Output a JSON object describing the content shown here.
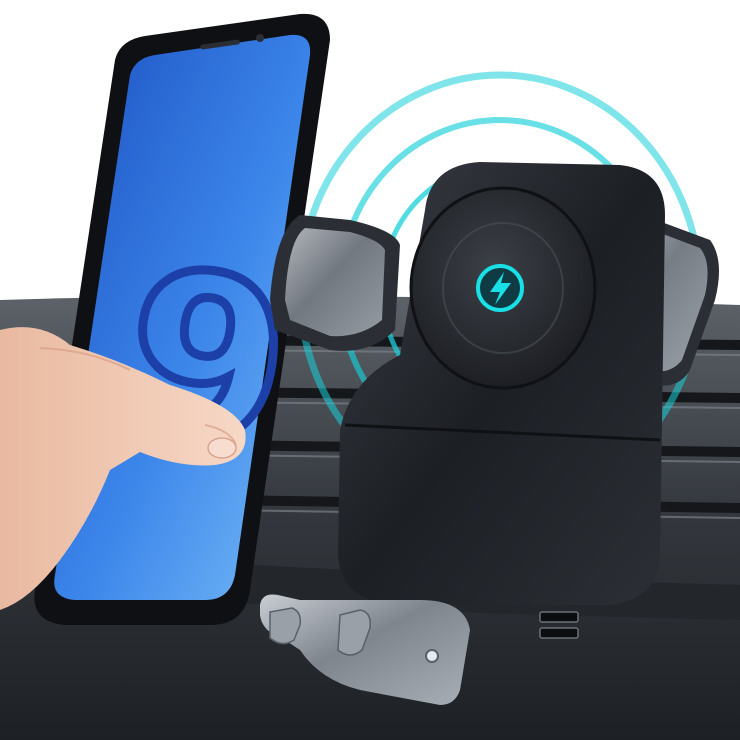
{
  "scene": {
    "subject": "wireless-charging-car-vent-phone-holder",
    "phone_screen_glyph": "9",
    "charge_icon": "lightning-bolt-icon",
    "colors": {
      "background": "#ffffff",
      "dashboard": "#2b2e33",
      "dashboard_light": "#5d6269",
      "phone_body": "#0e1014",
      "phone_screen": "#2a67d8",
      "phone_screen_light": "#5fa3f2",
      "numeral": "#1d3fa8",
      "holder_body": "#1c1f24",
      "arm_metal": "#8a9098",
      "glow_ring": "#17d0d8",
      "skin": "#f1cdb8"
    }
  }
}
